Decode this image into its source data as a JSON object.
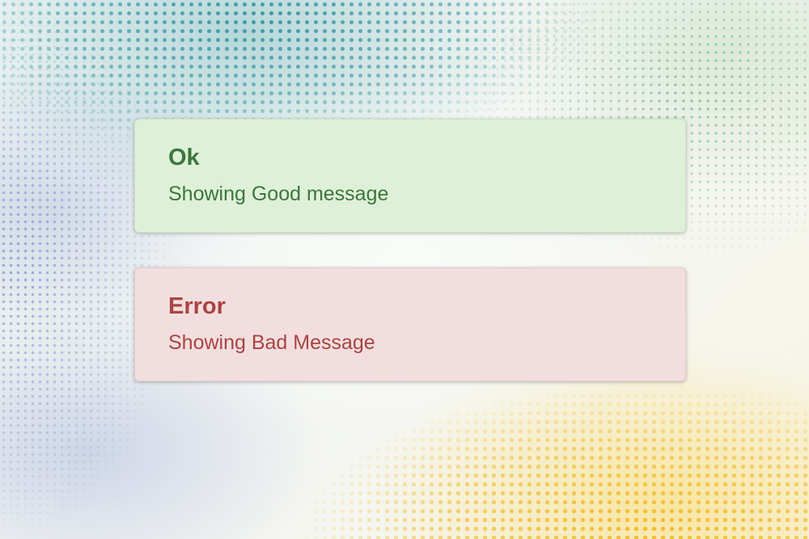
{
  "alerts": [
    {
      "type": "success",
      "title": "Ok",
      "message": "Showing Good message",
      "colors": {
        "background": "#dff0d8",
        "text": "#3c763d"
      }
    },
    {
      "type": "error",
      "title": "Error",
      "message": "Showing Bad Message",
      "colors": {
        "background": "#f2dede",
        "text": "#a94442"
      }
    }
  ]
}
